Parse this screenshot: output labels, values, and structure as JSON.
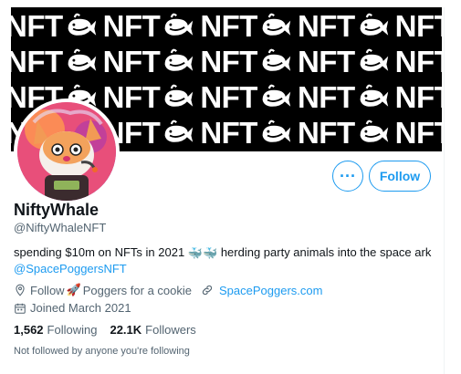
{
  "banner": {
    "word": "NFT",
    "rows": 4,
    "columns": 5
  },
  "profile": {
    "display_name": "NiftyWhale",
    "handle": "@NiftyWhaleNFT",
    "bio_text": "spending $10m on NFTs in 2021",
    "bio_emoji": "🐳🐳",
    "bio_text_2": "herding party animals into the space ark",
    "bio_mention": "@SpacePoggersNFT",
    "location_prefix": "Follow",
    "location_emoji": "🚀",
    "location_text": "Poggers for a cookie",
    "website": "SpacePoggers.com",
    "joined": "Joined March 2021"
  },
  "actions": {
    "more_label": "···",
    "follow_label": "Follow"
  },
  "stats": {
    "following_count": "1,562",
    "following_label": "Following",
    "followers_count": "22.1K",
    "followers_label": "Followers"
  },
  "note": "Not followed by anyone you're following",
  "colors": {
    "accent": "#1d9bf0",
    "text_primary": "#0f1419",
    "text_secondary": "#536471",
    "banner_bg": "#000000"
  },
  "icons": {
    "location": "location-pin-icon",
    "link": "link-icon",
    "calendar": "calendar-icon",
    "more": "more-dots-icon"
  }
}
